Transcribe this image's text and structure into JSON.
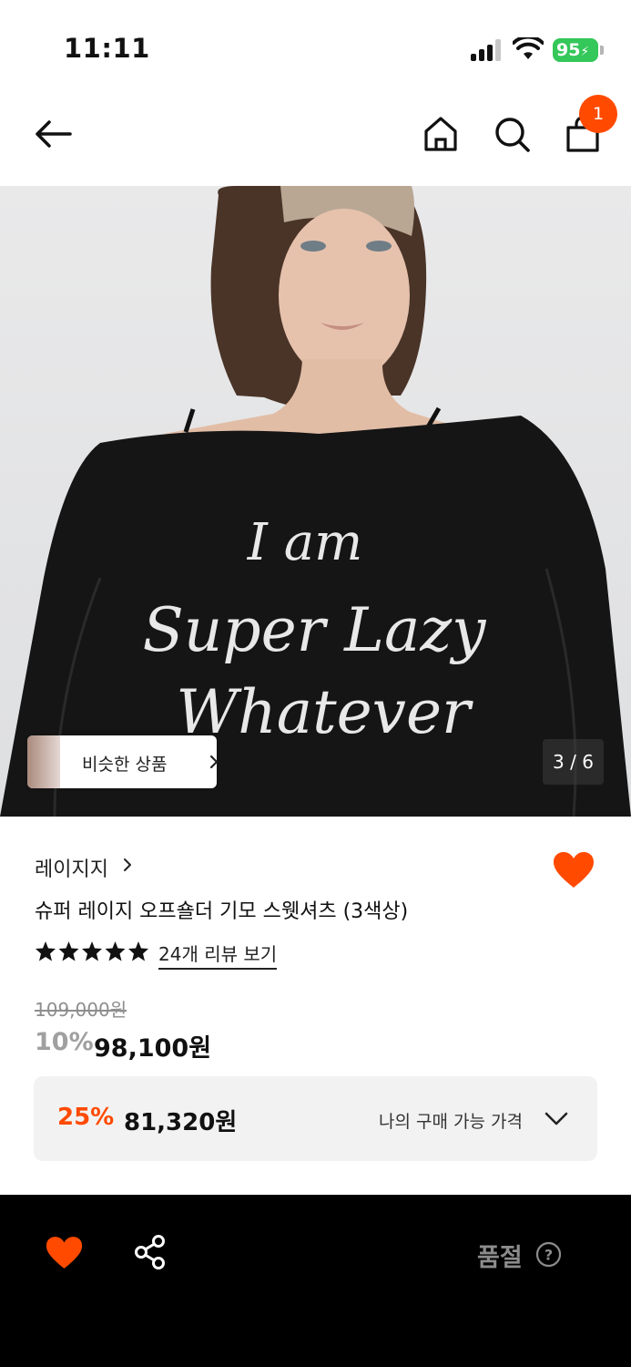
{
  "status_bar": {
    "time": "11:11",
    "battery": "95"
  },
  "header": {
    "cart_count": "1",
    "icons": [
      "back-arrow-icon",
      "home-icon",
      "search-icon",
      "shopping-bag-icon"
    ]
  },
  "gallery": {
    "similar_label": "비슷한 상품",
    "counter": "3 / 6",
    "shirt_text": [
      "I am",
      "Super Lazy",
      "Whatever"
    ]
  },
  "product": {
    "brand": "레이지지",
    "title": "슈퍼 레이지 오프숄더 기모 스웻셔츠 (3색상)",
    "rating_stars": 5,
    "review_link": "24개 리뷰 보기",
    "original_price": "109,000원",
    "discount_rate": "10%",
    "sale_price": "98,100원"
  },
  "my_price": {
    "rate": "25%",
    "price": "81,320원",
    "label": "나의 구매 가능 가격"
  },
  "bottom_bar": {
    "soldout": "품절"
  },
  "colors": {
    "accent": "#ff4a00",
    "battery": "#34c759",
    "bottom_bar": "#000000"
  }
}
